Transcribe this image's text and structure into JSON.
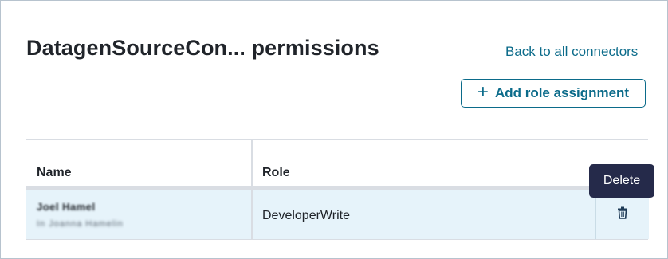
{
  "header": {
    "title": "DatagenSourceCon... permissions",
    "back_link": "Back to all connectors",
    "add_button_label": "Add role assignment"
  },
  "table": {
    "columns": [
      "Name",
      "Role"
    ],
    "rows": [
      {
        "name": "Joel Hamel",
        "subtitle": "In Joanna Hamelin",
        "role": "DeveloperWrite"
      }
    ]
  },
  "tooltip": {
    "label": "Delete"
  },
  "icons": {
    "add": "plus-icon",
    "delete": "trash-icon"
  },
  "colors": {
    "accent": "#0b6b8a",
    "row_highlight": "#e6f3fa",
    "tooltip_bg": "#252a4a"
  }
}
